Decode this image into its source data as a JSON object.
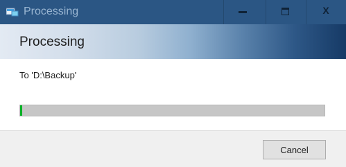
{
  "window": {
    "title": "Processing",
    "controls": {
      "minimize": "minimize",
      "maximize": "maximize",
      "close": "X"
    }
  },
  "header": {
    "title": "Processing"
  },
  "content": {
    "destination": "To 'D:\\Backup'",
    "progress_percent": 0.5
  },
  "footer": {
    "cancel_label": "Cancel"
  },
  "colors": {
    "titlebar": "#2b5684",
    "progress_fill": "#06b025",
    "progress_track": "#c6c6c6"
  }
}
